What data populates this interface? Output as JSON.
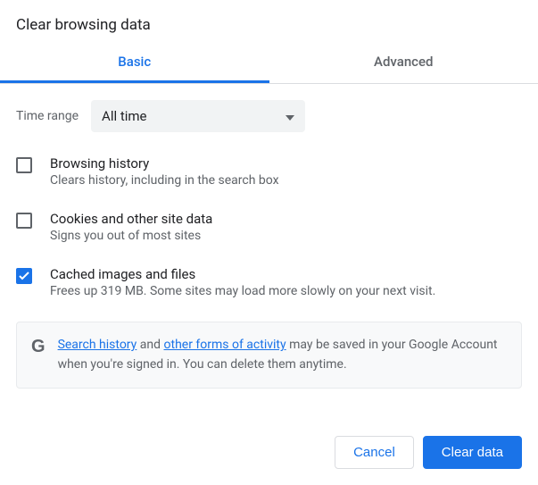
{
  "title": "Clear browsing data",
  "tabs": {
    "basic": "Basic",
    "advanced": "Advanced"
  },
  "range": {
    "label": "Time range",
    "value": "All time"
  },
  "options": {
    "browsing": {
      "title": "Browsing history",
      "desc": "Clears history, including in the search box",
      "checked": false
    },
    "cookies": {
      "title": "Cookies and other site data",
      "desc": "Signs you out of most sites",
      "checked": false
    },
    "cache": {
      "title": "Cached images and files",
      "desc": "Frees up 319 MB. Some sites may load more slowly on your next visit.",
      "checked": true
    }
  },
  "notice": {
    "link1": "Search history",
    "mid1": " and ",
    "link2": "other forms of activity",
    "rest": " may be saved in your Google Account when you're signed in. You can delete them anytime."
  },
  "buttons": {
    "cancel": "Cancel",
    "clear": "Clear data"
  }
}
